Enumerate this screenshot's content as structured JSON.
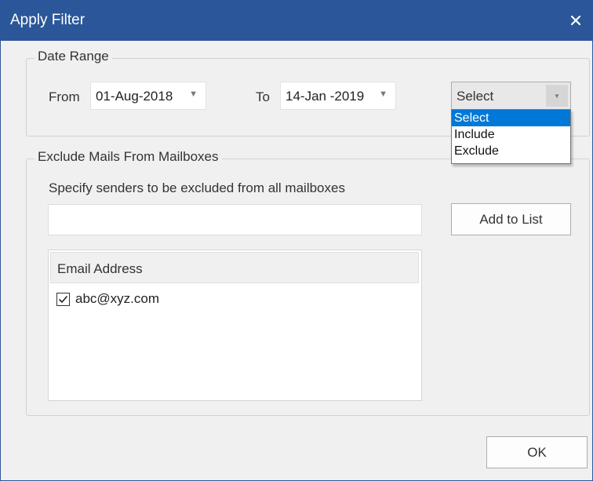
{
  "window": {
    "title": "Apply Filter"
  },
  "date_range": {
    "legend": "Date Range",
    "from_label": "From",
    "from_value": "01-Aug-2018",
    "to_label": "To",
    "to_value": "14-Jan -2019",
    "mode_selected": "Select",
    "mode_options": [
      "Select",
      "Include",
      "Exclude"
    ]
  },
  "exclude": {
    "legend": "Exclude Mails From Mailboxes",
    "instruction": "Specify senders to be excluded from all mailboxes",
    "sender_input_value": "",
    "add_button": "Add to List",
    "list_header": "Email Address",
    "rows": [
      {
        "email": "abc@xyz.com",
        "checked": true
      }
    ]
  },
  "ok_button": "OK",
  "colors": {
    "titlebar": "#2b579a",
    "selection": "#0078d7"
  }
}
